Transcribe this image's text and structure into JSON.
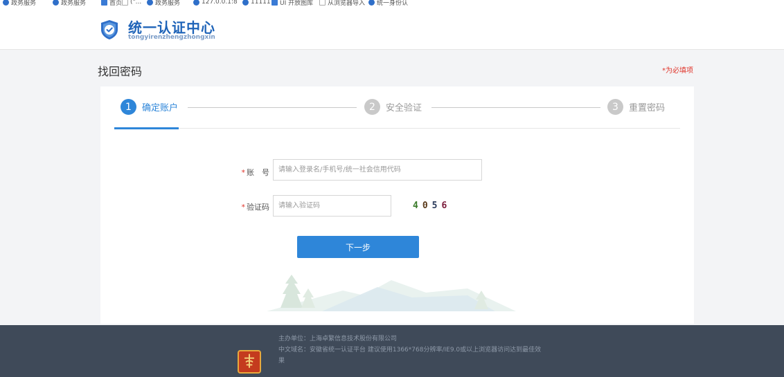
{
  "bookmarks": [
    {
      "label": "政务服务",
      "icon": "globe-icon"
    },
    {
      "label": "政务服务",
      "icon": "globe-icon"
    },
    {
      "label": "首页",
      "icon": "page-icon"
    },
    {
      "label": "(\"...",
      "icon": "folder-icon"
    },
    {
      "label": "政务服务",
      "icon": "globe-icon"
    },
    {
      "label": "127.0.0.1:8",
      "icon": "globe-icon"
    },
    {
      "label": "11111",
      "icon": "globe-icon"
    },
    {
      "label": "UI 开放图库",
      "icon": "page-icon"
    },
    {
      "label": "从浏览器导入",
      "icon": "folder-icon"
    },
    {
      "label": "统一身份认",
      "icon": "globe-icon"
    }
  ],
  "header": {
    "title": "统一认证中心",
    "subtitle": "tongyirenzhengzhongxin"
  },
  "page": {
    "title": "找回密码",
    "required_note": "*为必填项"
  },
  "steps": [
    {
      "num": "1",
      "label": "确定账户"
    },
    {
      "num": "2",
      "label": "安全验证"
    },
    {
      "num": "3",
      "label": "重置密码"
    }
  ],
  "form": {
    "account_label": "账　号",
    "account_placeholder": "请输入登录名/手机号/统一社会信用代码",
    "captcha_label": "验证码",
    "captcha_placeholder": "请输入验证码",
    "captcha_code": [
      "4",
      "0",
      "5",
      "6"
    ],
    "next_button": "下一步"
  },
  "footer": {
    "line1": "主办单位：上海卓繁信息技术股份有限公司",
    "line2": "中文域名：安徽省统一认证平台 建议使用1366*768分辨率/IE9.0或以上浏览器访问达到最佳效",
    "line3": "果"
  },
  "colors": {
    "accent": "#2e86d9",
    "brand": "#1e63b8",
    "required": "#e0352b",
    "footer_bg": "#3f4a59"
  }
}
